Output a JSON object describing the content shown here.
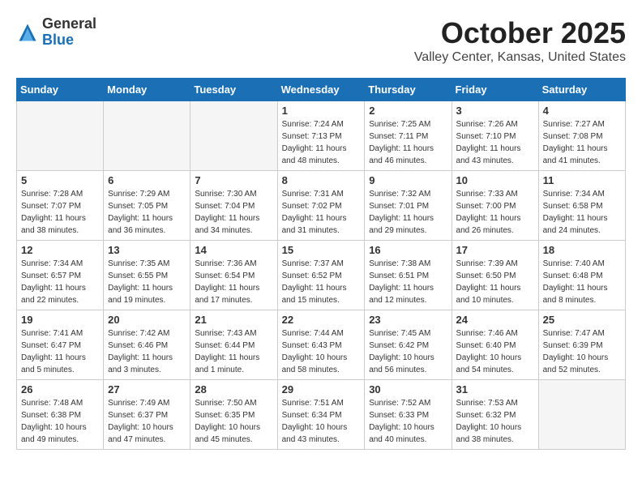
{
  "logo": {
    "general": "General",
    "blue": "Blue"
  },
  "header": {
    "month": "October 2025",
    "location": "Valley Center, Kansas, United States"
  },
  "weekdays": [
    "Sunday",
    "Monday",
    "Tuesday",
    "Wednesday",
    "Thursday",
    "Friday",
    "Saturday"
  ],
  "weeks": [
    [
      {
        "day": "",
        "empty": true
      },
      {
        "day": "",
        "empty": true
      },
      {
        "day": "",
        "empty": true
      },
      {
        "day": "1",
        "sunrise": "7:24 AM",
        "sunset": "7:13 PM",
        "daylight": "11 hours and 48 minutes."
      },
      {
        "day": "2",
        "sunrise": "7:25 AM",
        "sunset": "7:11 PM",
        "daylight": "11 hours and 46 minutes."
      },
      {
        "day": "3",
        "sunrise": "7:26 AM",
        "sunset": "7:10 PM",
        "daylight": "11 hours and 43 minutes."
      },
      {
        "day": "4",
        "sunrise": "7:27 AM",
        "sunset": "7:08 PM",
        "daylight": "11 hours and 41 minutes."
      }
    ],
    [
      {
        "day": "5",
        "sunrise": "7:28 AM",
        "sunset": "7:07 PM",
        "daylight": "11 hours and 38 minutes."
      },
      {
        "day": "6",
        "sunrise": "7:29 AM",
        "sunset": "7:05 PM",
        "daylight": "11 hours and 36 minutes."
      },
      {
        "day": "7",
        "sunrise": "7:30 AM",
        "sunset": "7:04 PM",
        "daylight": "11 hours and 34 minutes."
      },
      {
        "day": "8",
        "sunrise": "7:31 AM",
        "sunset": "7:02 PM",
        "daylight": "11 hours and 31 minutes."
      },
      {
        "day": "9",
        "sunrise": "7:32 AM",
        "sunset": "7:01 PM",
        "daylight": "11 hours and 29 minutes."
      },
      {
        "day": "10",
        "sunrise": "7:33 AM",
        "sunset": "7:00 PM",
        "daylight": "11 hours and 26 minutes."
      },
      {
        "day": "11",
        "sunrise": "7:34 AM",
        "sunset": "6:58 PM",
        "daylight": "11 hours and 24 minutes."
      }
    ],
    [
      {
        "day": "12",
        "sunrise": "7:34 AM",
        "sunset": "6:57 PM",
        "daylight": "11 hours and 22 minutes."
      },
      {
        "day": "13",
        "sunrise": "7:35 AM",
        "sunset": "6:55 PM",
        "daylight": "11 hours and 19 minutes."
      },
      {
        "day": "14",
        "sunrise": "7:36 AM",
        "sunset": "6:54 PM",
        "daylight": "11 hours and 17 minutes."
      },
      {
        "day": "15",
        "sunrise": "7:37 AM",
        "sunset": "6:52 PM",
        "daylight": "11 hours and 15 minutes."
      },
      {
        "day": "16",
        "sunrise": "7:38 AM",
        "sunset": "6:51 PM",
        "daylight": "11 hours and 12 minutes."
      },
      {
        "day": "17",
        "sunrise": "7:39 AM",
        "sunset": "6:50 PM",
        "daylight": "11 hours and 10 minutes."
      },
      {
        "day": "18",
        "sunrise": "7:40 AM",
        "sunset": "6:48 PM",
        "daylight": "11 hours and 8 minutes."
      }
    ],
    [
      {
        "day": "19",
        "sunrise": "7:41 AM",
        "sunset": "6:47 PM",
        "daylight": "11 hours and 5 minutes."
      },
      {
        "day": "20",
        "sunrise": "7:42 AM",
        "sunset": "6:46 PM",
        "daylight": "11 hours and 3 minutes."
      },
      {
        "day": "21",
        "sunrise": "7:43 AM",
        "sunset": "6:44 PM",
        "daylight": "11 hours and 1 minute."
      },
      {
        "day": "22",
        "sunrise": "7:44 AM",
        "sunset": "6:43 PM",
        "daylight": "10 hours and 58 minutes."
      },
      {
        "day": "23",
        "sunrise": "7:45 AM",
        "sunset": "6:42 PM",
        "daylight": "10 hours and 56 minutes."
      },
      {
        "day": "24",
        "sunrise": "7:46 AM",
        "sunset": "6:40 PM",
        "daylight": "10 hours and 54 minutes."
      },
      {
        "day": "25",
        "sunrise": "7:47 AM",
        "sunset": "6:39 PM",
        "daylight": "10 hours and 52 minutes."
      }
    ],
    [
      {
        "day": "26",
        "sunrise": "7:48 AM",
        "sunset": "6:38 PM",
        "daylight": "10 hours and 49 minutes."
      },
      {
        "day": "27",
        "sunrise": "7:49 AM",
        "sunset": "6:37 PM",
        "daylight": "10 hours and 47 minutes."
      },
      {
        "day": "28",
        "sunrise": "7:50 AM",
        "sunset": "6:35 PM",
        "daylight": "10 hours and 45 minutes."
      },
      {
        "day": "29",
        "sunrise": "7:51 AM",
        "sunset": "6:34 PM",
        "daylight": "10 hours and 43 minutes."
      },
      {
        "day": "30",
        "sunrise": "7:52 AM",
        "sunset": "6:33 PM",
        "daylight": "10 hours and 40 minutes."
      },
      {
        "day": "31",
        "sunrise": "7:53 AM",
        "sunset": "6:32 PM",
        "daylight": "10 hours and 38 minutes."
      },
      {
        "day": "",
        "empty": true
      }
    ]
  ]
}
